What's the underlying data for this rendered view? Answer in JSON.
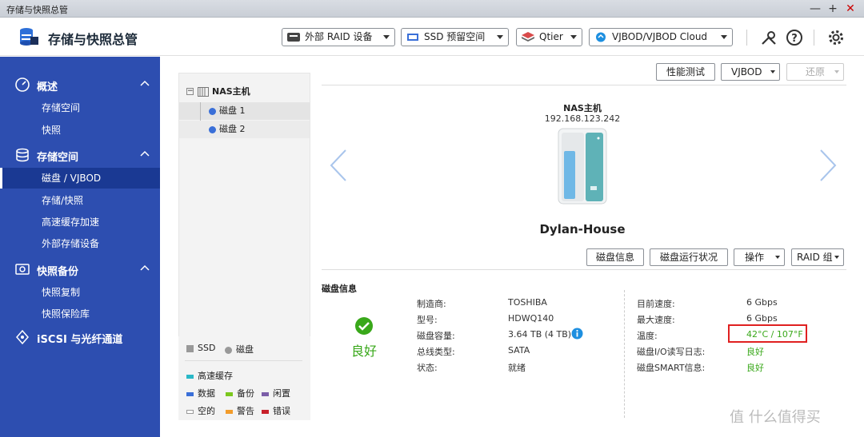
{
  "window": {
    "title": "存储与快照总管",
    "controls": [
      "—",
      "+",
      "✕"
    ]
  },
  "header": {
    "app_title": "存储与快照总管",
    "dropdowns": [
      {
        "label": "外部 RAID 设备",
        "icon": "raid-icon"
      },
      {
        "label": "SSD 预留空间",
        "icon": "ssd-icon"
      },
      {
        "label": "Qtier",
        "icon": "qtier-icon"
      },
      {
        "label": "VJBOD/VJBOD Cloud",
        "icon": "vjbod-cloud-icon"
      }
    ],
    "icons": [
      "tools-icon",
      "help-icon",
      "settings-icon"
    ]
  },
  "sidebar": {
    "sections": [
      {
        "label": "概述",
        "icon": "dashboard-icon",
        "items": [
          "存储空间",
          "快照"
        ]
      },
      {
        "label": "存储空间",
        "icon": "storage-icon",
        "items": [
          "磁盘 / VJBOD",
          "存储/快照",
          "高速缓存加速",
          "外部存储设备"
        ]
      },
      {
        "label": "快照备份",
        "icon": "snapshot-icon",
        "items": [
          "快照复制",
          "快照保险库"
        ]
      },
      {
        "label": "iSCSI 与光纤通道",
        "icon": "iscsi-icon",
        "items": []
      }
    ],
    "active_item": "磁盘 / VJBOD"
  },
  "tree": {
    "root": "NAS主机",
    "children": [
      "磁盘 1",
      "磁盘 2"
    ]
  },
  "legend": {
    "types": [
      "SSD",
      "磁盘"
    ],
    "cache_label": "高速缓存",
    "items": [
      {
        "label": "数据",
        "color": "#3a6fd8"
      },
      {
        "label": "备份",
        "color": "#7bc71e"
      },
      {
        "label": "闲置",
        "color": "#7b5ea8"
      },
      {
        "label": "空的",
        "color": "#ffffff"
      },
      {
        "label": "警告",
        "color": "#f29c2b"
      },
      {
        "label": "错误",
        "color": "#c8202a"
      }
    ],
    "cache_color": "#2ab8c7"
  },
  "toolbar": {
    "perf_test": "性能测试",
    "vjbod": "VJBOD",
    "restore": "还原"
  },
  "device": {
    "label": "NAS主机",
    "ip": "192.168.123.242",
    "name": "Dylan-House"
  },
  "actions": {
    "disk_info": "磁盘信息",
    "disk_health": "磁盘运行状况",
    "operation": "操作",
    "raid_group": "RAID 组"
  },
  "disk_info": {
    "section_title": "磁盘信息",
    "status": "良好",
    "left": [
      {
        "label": "制造商:",
        "value": "TOSHIBA"
      },
      {
        "label": "型号:",
        "value": "HDWQ140"
      },
      {
        "label": "磁盘容量:",
        "value": "3.64 TB (4 TB)"
      },
      {
        "label": "总线类型:",
        "value": "SATA"
      },
      {
        "label": "状态:",
        "value": "就绪"
      }
    ],
    "right": [
      {
        "label": "目前速度:",
        "value": "6 Gbps"
      },
      {
        "label": "最大速度:",
        "value": "6 Gbps"
      },
      {
        "label": "温度:",
        "value": "42°C / 107°F"
      },
      {
        "label": "磁盘I/O读写日志:",
        "value": "良好"
      },
      {
        "label": "磁盘SMART信息:",
        "value": "良好"
      }
    ]
  },
  "watermark": "值 什么值得买"
}
